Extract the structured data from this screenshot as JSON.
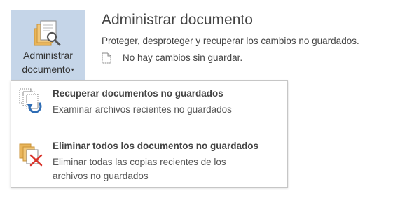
{
  "manage_button": {
    "line1": "Administrar",
    "line2": "documento",
    "caret": "▾",
    "icon": "manage-documents-icon"
  },
  "section": {
    "title": "Administrar documento",
    "description": "Proteger, desproteger y recuperar los cambios no guardados.",
    "status": "No hay cambios sin guardar.",
    "status_icon": "document-icon"
  },
  "menu": {
    "items": [
      {
        "title": "Recuperar documentos no guardados",
        "description": "Examinar archivos recientes no guardados",
        "icon": "recover-documents-icon"
      },
      {
        "title": "Eliminar todos los documentos no guardados",
        "description": "Eliminar todas las copias recientes de los archivos no guardados",
        "icon": "delete-documents-icon"
      }
    ]
  },
  "colors": {
    "button_bg": "#c5d5e8",
    "button_border": "#99b3d6",
    "folder": "#e9b55a",
    "recover_arrow": "#2f6db5",
    "delete_x": "#d9342b"
  }
}
